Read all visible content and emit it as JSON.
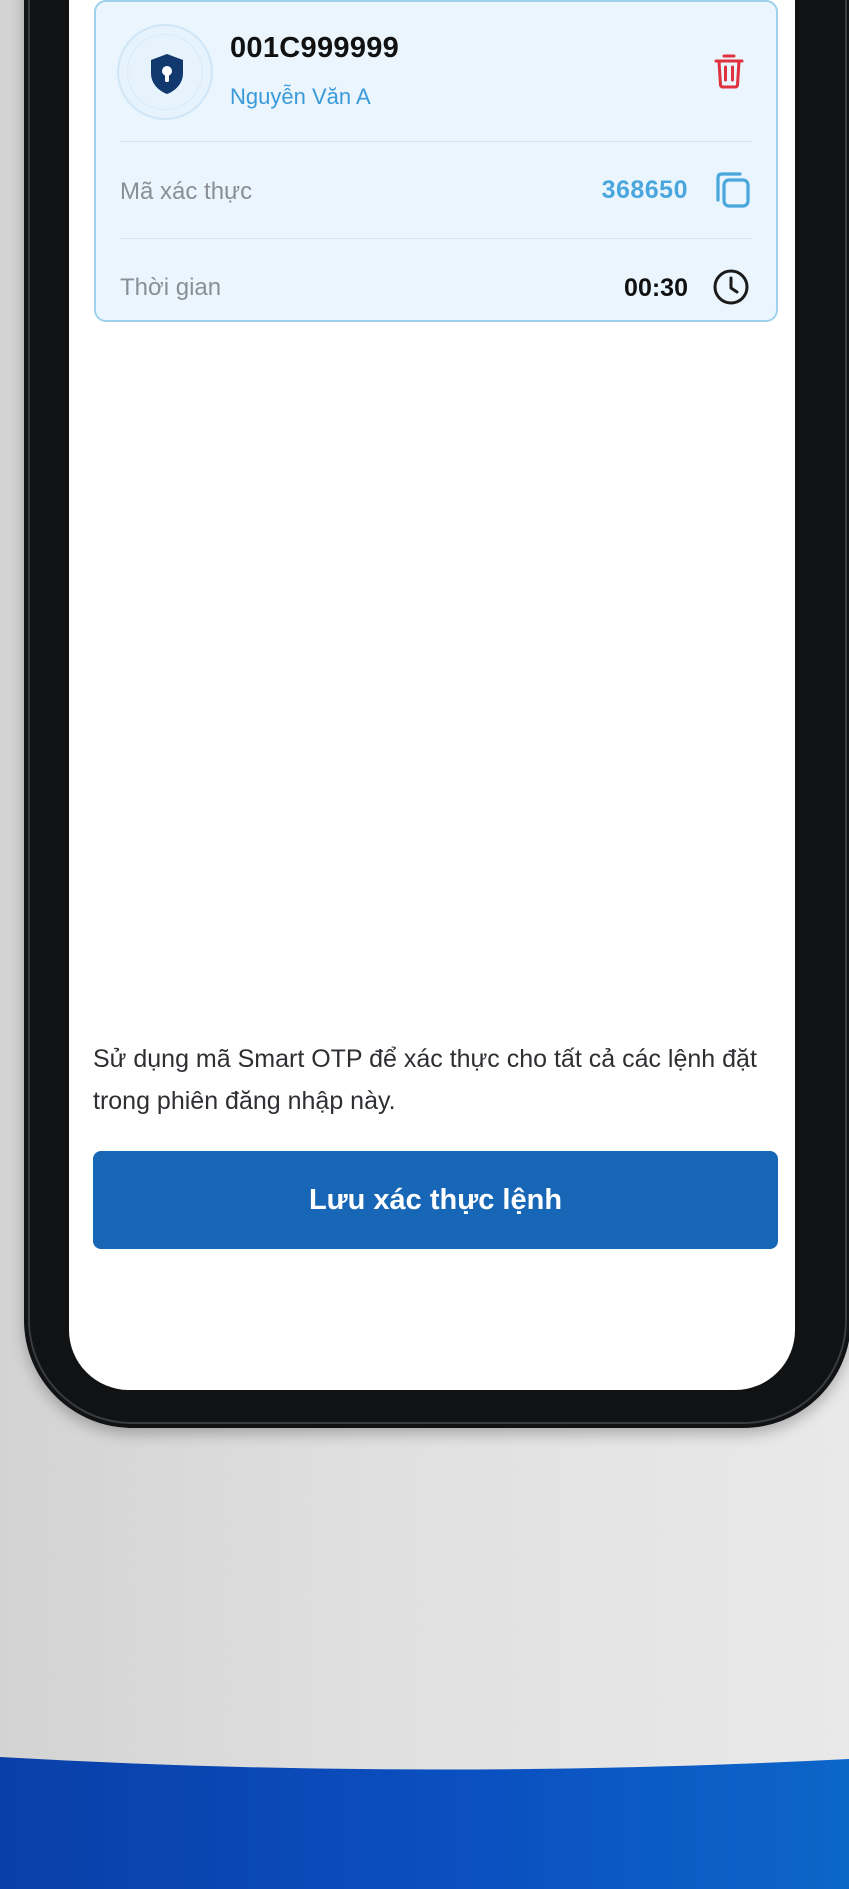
{
  "account": {
    "id": "001C999999",
    "name": "Nguyễn Văn A"
  },
  "otp": {
    "label": "Mã xác thực",
    "value": "368650"
  },
  "timer": {
    "label": "Thời gian",
    "value": "00:30"
  },
  "note": "Sử dụng mã Smart OTP để xác thực cho tất cả các lệnh đặt trong phiên đăng nhập này.",
  "save_button": "Lưu xác thực lệnh",
  "icons": {
    "shield": "shield-keyhole-icon",
    "delete": "trash-icon",
    "copy": "copy-icon",
    "timer": "clock-icon"
  },
  "colors": {
    "primary_button": "#1767b6",
    "accent_blue": "#3a9ad9",
    "otp_blue": "#4aa7de",
    "danger_red": "#e0313f",
    "card_background": "#ebf5fd",
    "card_border": "#9fd0ee",
    "banner_blue": "#0b4fc0"
  }
}
